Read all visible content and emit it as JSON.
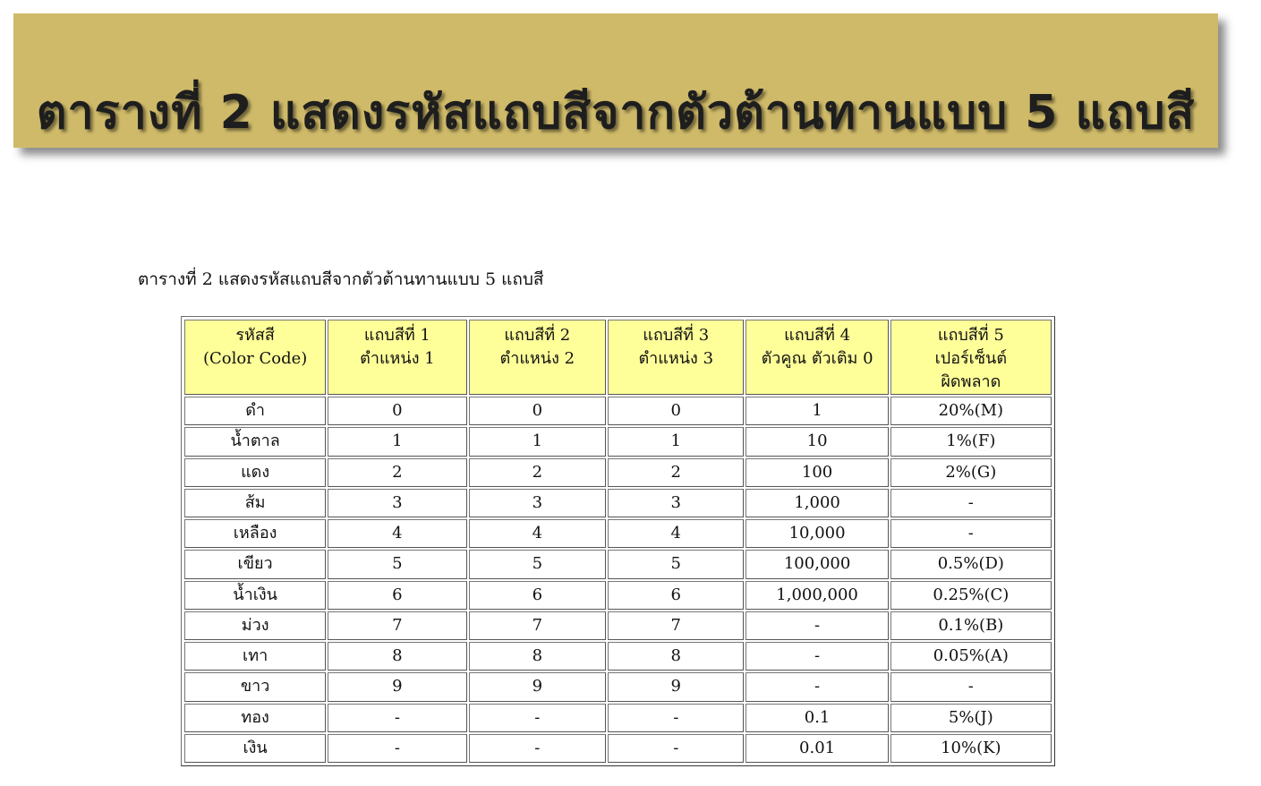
{
  "banner": {
    "title": "ตารางที่ 2 แสดงรหัสแถบสีจากตัวต้านทานแบบ 5 แถบสี"
  },
  "caption": "ตารางที่ 2 แสดงรหัสแถบสีจากตัวต้านทานแบบ 5 แถบสี",
  "table": {
    "headers": [
      [
        "รหัสสี",
        "(Color Code)"
      ],
      [
        "แถบสีที่ 1",
        "ตำแหน่ง 1"
      ],
      [
        "แถบสีที่ 2",
        "ตำแหน่ง 2"
      ],
      [
        "แถบสีที่ 3",
        "ตำแหน่ง 3"
      ],
      [
        "แถบสีที่ 4",
        "ตัวคูณ ตัวเติม 0"
      ],
      [
        "แถบสีที่ 5",
        "เปอร์เซ็นต์",
        "ผิดพลาด"
      ]
    ],
    "rows": [
      [
        "ดำ",
        "0",
        "0",
        "0",
        "1",
        "20%(M)"
      ],
      [
        "น้ำตาล",
        "1",
        "1",
        "1",
        "10",
        "1%(F)"
      ],
      [
        "แดง",
        "2",
        "2",
        "2",
        "100",
        "2%(G)"
      ],
      [
        "ส้ม",
        "3",
        "3",
        "3",
        "1,000",
        "-"
      ],
      [
        "เหลือง",
        "4",
        "4",
        "4",
        "10,000",
        "-"
      ],
      [
        "เขียว",
        "5",
        "5",
        "5",
        "100,000",
        "0.5%(D)"
      ],
      [
        "น้ำเงิน",
        "6",
        "6",
        "6",
        "1,000,000",
        "0.25%(C)"
      ],
      [
        "ม่วง",
        "7",
        "7",
        "7",
        "-",
        "0.1%(B)"
      ],
      [
        "เทา",
        "8",
        "8",
        "8",
        "-",
        "0.05%(A)"
      ],
      [
        "ขาว",
        "9",
        "9",
        "9",
        "-",
        "-"
      ],
      [
        "ทอง",
        "-",
        "-",
        "-",
        "0.1",
        "5%(J)"
      ],
      [
        "เงิน",
        "-",
        "-",
        "-",
        "0.01",
        "10%(K)"
      ]
    ]
  },
  "colors": {
    "banner_bg": "#cfba69",
    "header_bg": "#ffff99"
  }
}
